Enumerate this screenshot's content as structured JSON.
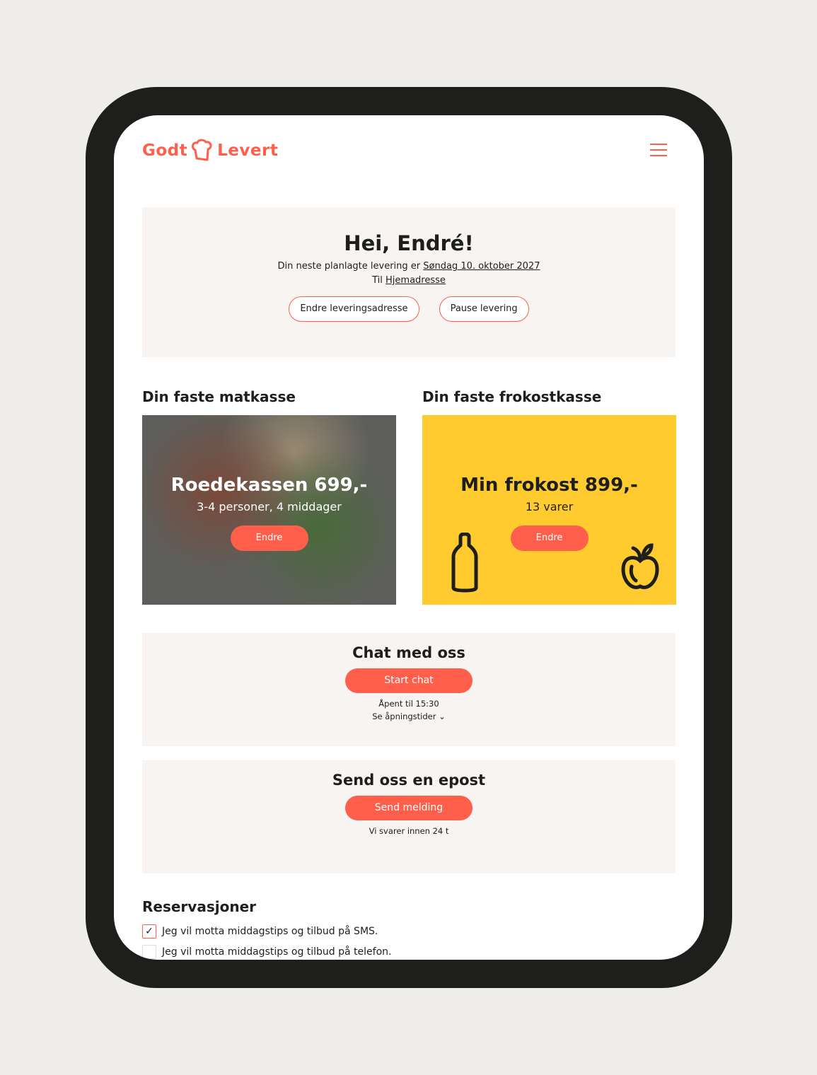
{
  "brand": {
    "logo_text_left": "Godt",
    "logo_text_right": "Levert",
    "accent": "#ff5f4b",
    "yellow": "#ffcb2f"
  },
  "header": {
    "menu_icon": "hamburger-icon"
  },
  "greeting": {
    "title": "Hei, Endré!",
    "delivery_prefix": "Din neste planlagte levering er",
    "delivery_date": "Søndag 10. oktober 2027",
    "to_prefix": "Til",
    "address": "Hjemadresse",
    "change_address": "Endre leveringsadresse",
    "pause": "Pause levering"
  },
  "dinner_box": {
    "heading": "Din faste matkasse",
    "title": "Roedekassen 699,-",
    "subtitle": "3-4 personer, 4 middager",
    "button": "Endre"
  },
  "breakfast_box": {
    "heading": "Din faste frokostkasse",
    "title": "Min frokost 899,-",
    "subtitle": "13 varer",
    "button": "Endre",
    "icons": [
      "bottle-icon",
      "apple-icon"
    ]
  },
  "chat": {
    "title": "Chat med oss",
    "button": "Start chat",
    "open_until": "Åpent til 15:30",
    "hours_link": "Se åpningstider"
  },
  "email": {
    "title": "Send oss en epost",
    "button": "Send melding",
    "note": "Vi svarer innen 24 t"
  },
  "reservations": {
    "title": "Reservasjoner",
    "items": [
      {
        "label": "Jeg vil motta middagstips og tilbud på SMS.",
        "checked": true
      },
      {
        "label": "Jeg vil motta middagstips og tilbud på telefon.",
        "checked": false
      }
    ]
  }
}
